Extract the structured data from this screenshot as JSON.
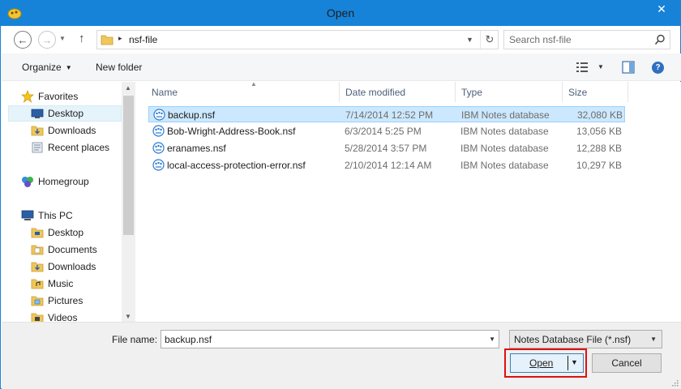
{
  "window": {
    "title": "Open",
    "close_glyph": "✕",
    "app_icon": "app-icon",
    "colors": {
      "titlebar": "#1683d8",
      "selection": "#cce8ff",
      "highlight": "#e00f0f"
    }
  },
  "address": {
    "path": "nsf-file",
    "separator": "▸",
    "back_glyph": "←",
    "forward_glyph": "→",
    "up_glyph": "↑",
    "refresh_glyph": "↻",
    "search_placeholder": "Search nsf-file"
  },
  "toolbar": {
    "organize_label": "Organize",
    "new_folder_label": "New folder",
    "help_glyph": "?"
  },
  "nav": {
    "favorites": "Favorites",
    "desktop": "Desktop",
    "downloads": "Downloads",
    "recent_places": "Recent places",
    "homegroup": "Homegroup",
    "this_pc": "This PC",
    "pc_items": [
      "Desktop",
      "Documents",
      "Downloads",
      "Music",
      "Pictures",
      "Videos"
    ]
  },
  "columns": {
    "name": "Name",
    "date": "Date modified",
    "type": "Type",
    "size": "Size"
  },
  "files": [
    {
      "name": "backup.nsf",
      "date": "7/14/2014 12:52 PM",
      "type": "IBM Notes database",
      "size": "32,080 KB",
      "selected": true
    },
    {
      "name": "Bob-Wright-Address-Book.nsf",
      "date": "6/3/2014 5:25 PM",
      "type": "IBM Notes database",
      "size": "13,056 KB",
      "selected": false
    },
    {
      "name": "eranames.nsf",
      "date": "5/28/2014 3:57 PM",
      "type": "IBM Notes database",
      "size": "12,288 KB",
      "selected": false
    },
    {
      "name": "local-access-protection-error.nsf",
      "date": "2/10/2014 12:14 AM",
      "type": "IBM Notes database",
      "size": "10,297 KB",
      "selected": false
    }
  ],
  "bottom": {
    "file_name_label": "File name:",
    "file_name_value": "backup.nsf",
    "file_type": "Notes Database File (*.nsf)",
    "open_label": "Open",
    "cancel_label": "Cancel"
  }
}
